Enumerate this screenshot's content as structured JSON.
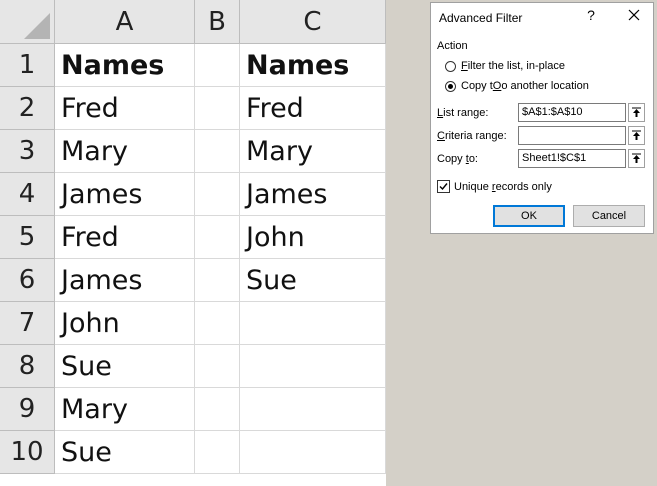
{
  "sheet": {
    "columns": [
      "A",
      "B",
      "C"
    ],
    "rows": [
      "1",
      "2",
      "3",
      "4",
      "5",
      "6",
      "7",
      "8",
      "9",
      "10"
    ],
    "colA": [
      "Names",
      "Fred",
      "Mary",
      "James",
      "Fred",
      "James",
      "John",
      "Sue",
      "Mary",
      "Sue"
    ],
    "colB": [
      "",
      "",
      "",
      "",
      "",
      "",
      "",
      "",
      "",
      ""
    ],
    "colC": [
      "Names",
      "Fred",
      "Mary",
      "James",
      "John",
      "Sue",
      "",
      "",
      "",
      ""
    ]
  },
  "dialog": {
    "title": "Advanced Filter",
    "help": "?",
    "action_label": "Action",
    "radio_filter_inplace": {
      "hotkey": "F",
      "rest": "ilter the list, in-place",
      "checked": false
    },
    "radio_copy_other": {
      "hotkey": "O",
      "rest": "Copy t",
      "pre": "",
      "after": "o another location",
      "checked": true
    },
    "list_range_label": {
      "pre": "",
      "hotkey": "L",
      "rest": "ist range:"
    },
    "list_range_value": "$A$1:$A$10",
    "criteria_range_label": {
      "pre": "",
      "hotkey": "C",
      "rest": "riteria range:"
    },
    "criteria_range_value": "",
    "copy_to_label": {
      "pre": "Copy ",
      "hotkey": "t",
      "rest": "o:"
    },
    "copy_to_value": "Sheet1!$C$1",
    "unique_label": {
      "pre": "Unique ",
      "hotkey": "r",
      "rest": "ecords only"
    },
    "unique_checked": true,
    "ok_label": "OK",
    "cancel_label": "Cancel"
  }
}
